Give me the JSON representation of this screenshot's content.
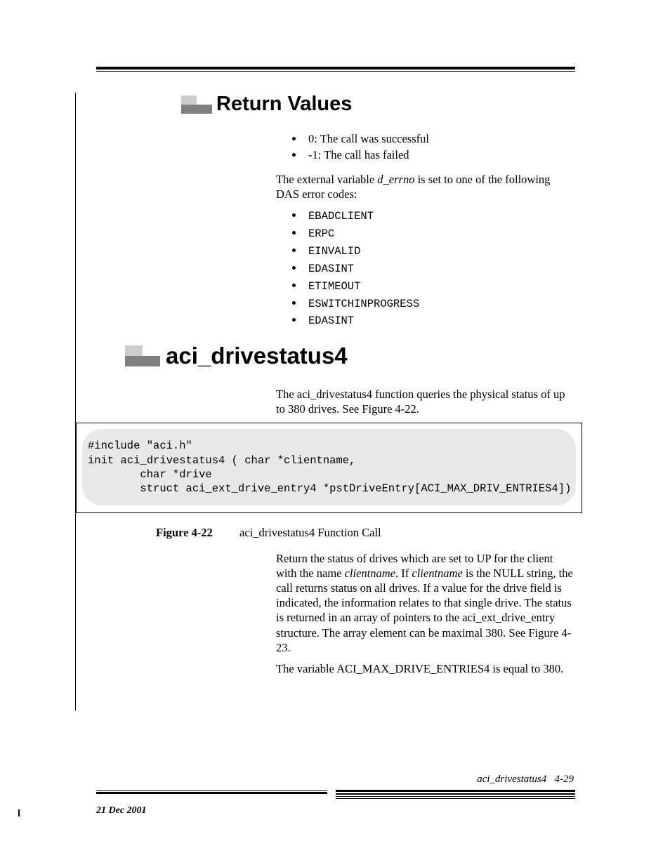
{
  "section1": {
    "heading": "Return Values",
    "bullets": [
      "0: The call was successful",
      "-1: The call has failed"
    ],
    "intro_pre": "The external variable ",
    "intro_var": "d_errno",
    "intro_post": " is set to one of the following DAS error codes:",
    "codes": [
      "EBADCLIENT",
      "ERPC",
      "EINVALID",
      "EDASINT",
      "ETIMEOUT",
      "ESWITCHINPROGRESS",
      "EDASINT"
    ]
  },
  "section2": {
    "heading": "aci_drivestatus4",
    "intro": "The aci_drivestatus4 function queries the physical status of up to 380 drives. See Figure 4-22.",
    "code": "#include \"aci.h\"\ninit aci_drivestatus4 ( char *clientname,\n        char *drive\n        struct aci_ext_drive_entry4 *pstDriveEntry[ACI_MAX_DRIV_ENTRIES4])",
    "figure_label": "Figure 4-22",
    "figure_caption": "aci_drivestatus4 Function Call",
    "para1_a": "Return the status of drives which are set to UP for the client with the name ",
    "para1_b": "clientname",
    "para1_c": ". If ",
    "para1_d": "clientname",
    "para1_e": " is the NULL string, the call returns status on all drives. If a value for the drive field is indicated, the information relates to that single drive. The status is returned in an array of pointers to the aci_ext_drive_entry structure. The array element can be maximal 380. See Figure 4-23.",
    "para2": "The variable ACI_MAX_DRIVE_ENTRIES4 is equal to 380."
  },
  "footer": {
    "right_title": "aci_drivestatus4",
    "right_page": "4-29",
    "date": "21 Dec 2001"
  }
}
